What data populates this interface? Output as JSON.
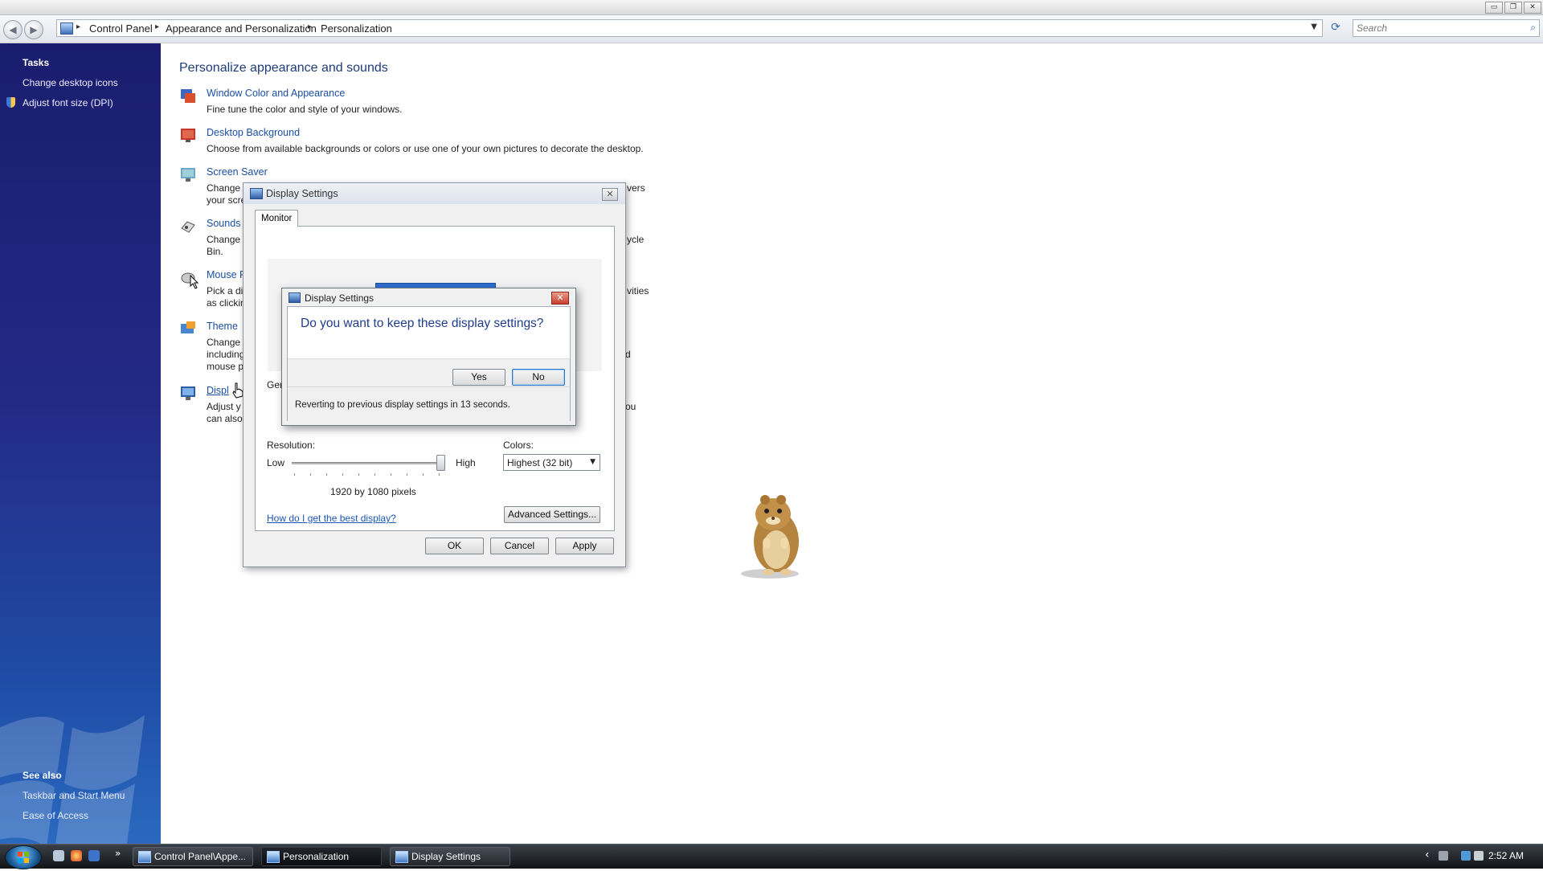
{
  "window": {
    "minimize": "▭",
    "restore": "❐",
    "close": "✕"
  },
  "address_bar": {
    "breadcrumbs": [
      "Control Panel",
      "Appearance and Personalization",
      "Personalization"
    ],
    "search_placeholder": "Search"
  },
  "sidebar": {
    "tasks_heading": "Tasks",
    "tasks": [
      "Change desktop icons",
      "Adjust font size (DPI)"
    ],
    "see_also_heading": "See also",
    "see_also": [
      "Taskbar and Start Menu",
      "Ease of Access"
    ]
  },
  "main": {
    "title": "Personalize appearance and sounds",
    "items": [
      {
        "link": "Window Color and Appearance",
        "desc": "Fine tune the color and style of your windows."
      },
      {
        "link": "Desktop Background",
        "desc": "Choose from available backgrounds or colors or use one of your own pictures to decorate the desktop."
      },
      {
        "link": "Screen Saver",
        "desc1": "Change",
        "desc2": "your scre",
        "tail": "vers"
      },
      {
        "link": "Sounds",
        "desc1": "Change",
        "desc2": "Bin.",
        "tail": "ycle"
      },
      {
        "link": "Mouse P",
        "desc1": "Pick a di",
        "desc2": "as clickin",
        "tail": "vities"
      },
      {
        "link": "Theme",
        "desc1": "Change",
        "desc2": "including",
        "desc3": "mouse p",
        "tail": "d"
      },
      {
        "link": "Displ",
        "desc1": "Adjust y",
        "desc2": "can also",
        "tail": "ou"
      }
    ]
  },
  "display_settings": {
    "title": "Display Settings",
    "tab": "Monitor",
    "general_partial": "Ger",
    "resolution_label": "Resolution:",
    "low": "Low",
    "high": "High",
    "resolution_value": "1920 by 1080 pixels",
    "resolution_level": 1.0,
    "colors_label": "Colors:",
    "colors_value": "Highest (32 bit)",
    "help_link": "How do I get the best display?",
    "advanced_button": "Advanced Settings...",
    "ok": "OK",
    "cancel": "Cancel",
    "apply": "Apply"
  },
  "confirm_dialog": {
    "title": "Display Settings",
    "question": "Do you want to keep these display settings?",
    "yes": "Yes",
    "no": "No",
    "countdown": "Reverting to previous display settings in 13 seconds."
  },
  "taskbar": {
    "buttons": [
      "Control Panel\\Appe...",
      "Personalization",
      "Display Settings"
    ],
    "overflow": "»",
    "tray_arrow": "‹",
    "clock": "2:52 AM"
  },
  "colors": {
    "sidebar_top": "#1a1d6e",
    "sidebar_bottom": "#2a69bf",
    "link": "#1a4fa3",
    "accent": "#2f77c9"
  }
}
